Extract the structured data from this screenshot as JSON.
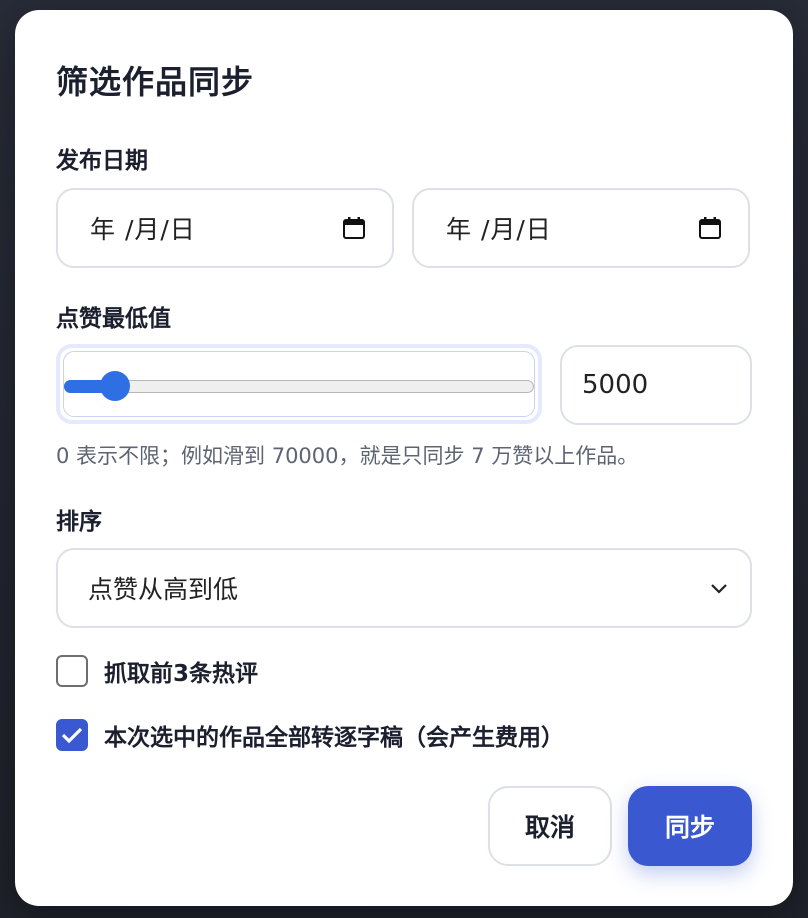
{
  "dialog": {
    "title": "筛选作品同步",
    "date_label": "发布日期",
    "date_start_value": "年 /月/日",
    "date_end_value": "年 /月/日",
    "likes_label": "点赞最低值",
    "likes_slider": {
      "min": 0,
      "max": 100000,
      "value": 5000
    },
    "likes_value": "5000",
    "likes_hint": "0 表示不限；例如滑到 70000，就是只同步 7 万赞以上作品。",
    "sort_label": "排序",
    "sort_selected": "点赞从高到低",
    "fetch_comments_label": "抓取前3条热评",
    "fetch_comments_checked": false,
    "transcribe_label": "本次选中的作品全部转逐字稿（会产生费用）",
    "transcribe_checked": true,
    "cancel_label": "取消",
    "sync_label": "同步"
  },
  "colors": {
    "accent": "#3a59d1",
    "slider": "#2f6fe4",
    "text": "#1b1f2e",
    "muted": "#5d6472",
    "border": "#dde0e6"
  },
  "icons": {
    "calendar": "calendar-icon",
    "chevron": "chevron-down-icon",
    "check": "checkmark-icon"
  }
}
